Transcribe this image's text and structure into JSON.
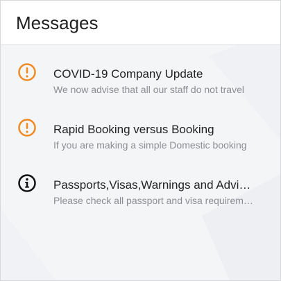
{
  "header": {
    "title": "Messages"
  },
  "colors": {
    "warning": "#f08a24",
    "info": "#111111",
    "title_text": "#222222",
    "preview_text": "#8a8d92"
  },
  "messages": [
    {
      "icon": "warning-circle-icon",
      "title": "COVID-19 Company Update",
      "preview": "We now advise that all our staff do not travel"
    },
    {
      "icon": "warning-circle-icon",
      "title": "Rapid Booking versus Booking",
      "preview": "If you are making a simple Domestic booking"
    },
    {
      "icon": "info-circle-icon",
      "title": "Passports,Visas,Warnings and Advisories",
      "preview": "Please check all passport and visa requirements"
    }
  ]
}
